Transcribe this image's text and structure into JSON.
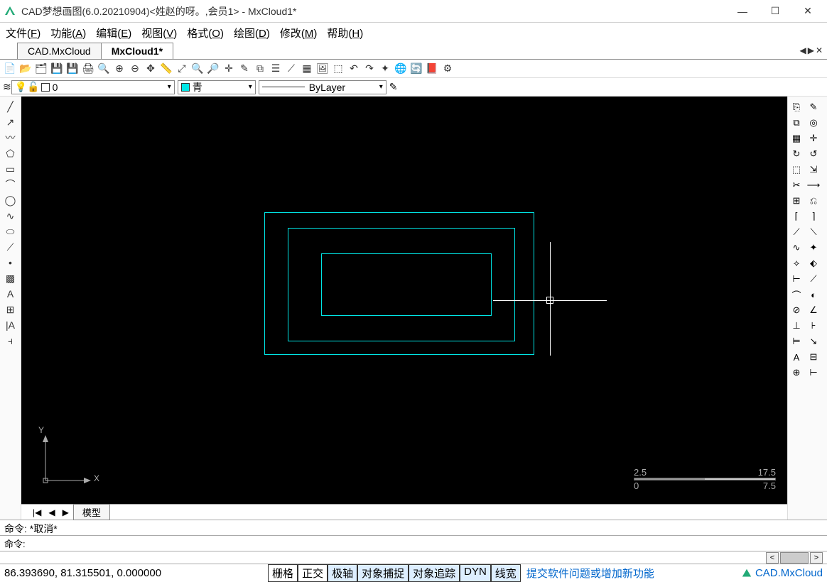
{
  "titlebar": {
    "title": "CAD梦想画图(6.0.20210904)<姓赵的呀。,会员1> - MxCloud1*"
  },
  "menubar": [
    {
      "label": "文件",
      "accel": "F"
    },
    {
      "label": "功能",
      "accel": "A"
    },
    {
      "label": "编辑",
      "accel": "E"
    },
    {
      "label": "视图",
      "accel": "V"
    },
    {
      "label": "格式",
      "accel": "O"
    },
    {
      "label": "绘图",
      "accel": "D"
    },
    {
      "label": "修改",
      "accel": "M"
    },
    {
      "label": "帮助",
      "accel": "H"
    }
  ],
  "doctabs": [
    {
      "label": "CAD.MxCloud",
      "active": false
    },
    {
      "label": "MxCloud1*",
      "active": true
    }
  ],
  "layer": {
    "value": "0"
  },
  "color": {
    "label": "青",
    "swatch": "#00e6e6"
  },
  "linetype": {
    "label": "ByLayer"
  },
  "ruler": {
    "topLeft": "2.5",
    "topRight": "17.5",
    "botLeft": "0",
    "botRight": "7.5"
  },
  "axis": {
    "x": "X",
    "y": "Y"
  },
  "model_tab": "模型",
  "cmd_history": "命令:   *取消*",
  "cmd_prompt": "命令:",
  "coords": "86.393690, 81.315501, 0.000000",
  "toggles": [
    "栅格",
    "正交",
    "极轴",
    "对象捕捉",
    "对象追踪",
    "DYN",
    "线宽"
  ],
  "toggles_on": [
    2,
    3,
    4,
    5,
    6
  ],
  "feedback_link": "提交软件问题或增加新功能",
  "brand": "CAD.MxCloud"
}
